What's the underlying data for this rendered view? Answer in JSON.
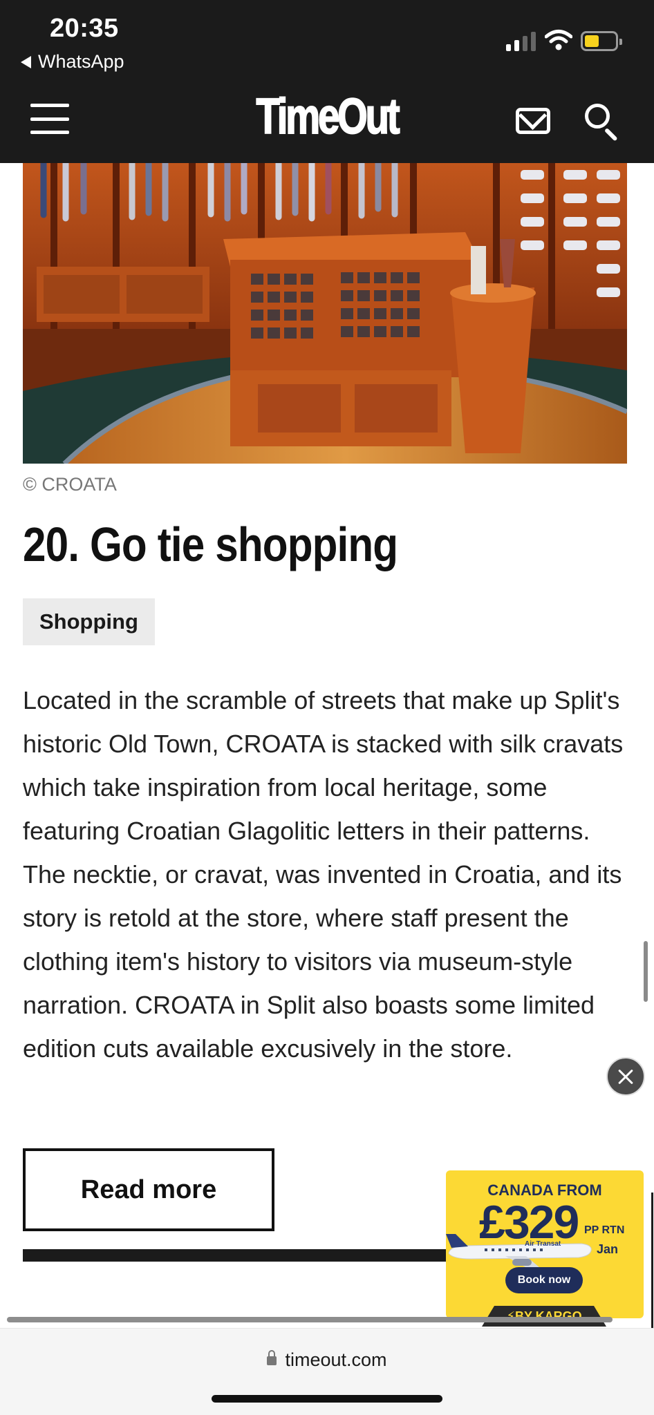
{
  "status_bar": {
    "time": "20:35",
    "back_app": "WhatsApp"
  },
  "header": {
    "logo": "TimeOut",
    "icons": [
      "menu-icon",
      "mail-icon",
      "search-icon"
    ]
  },
  "article": {
    "image_credit": "© CROATA",
    "title": "20. Go tie shopping",
    "tag": "Shopping",
    "body": "Located in the scramble of streets that make up Split's historic Old Town, CROATA is stacked with silk cravats which take inspiration from local heritage, some featuring Croatian Glagolitic letters in their patterns. The necktie, or cravat, was invented in Croatia, and its story is retold at the store, where staff present the clothing item's history to visitors via museum-style narration. CROATA in Split also boasts some limited edition cuts available excusively in the store.",
    "read_more_label": "Read more"
  },
  "ad": {
    "heading": "CANADA FROM",
    "price": "£329",
    "price_suffix": "PP RTN",
    "month": "Jan",
    "airline": "Air Transat",
    "cta": "Book now",
    "attribution": "⚡BY KARGO",
    "brand_color": "#fcd934",
    "text_color": "#1f2d5a"
  },
  "browser": {
    "url": "timeout.com"
  }
}
